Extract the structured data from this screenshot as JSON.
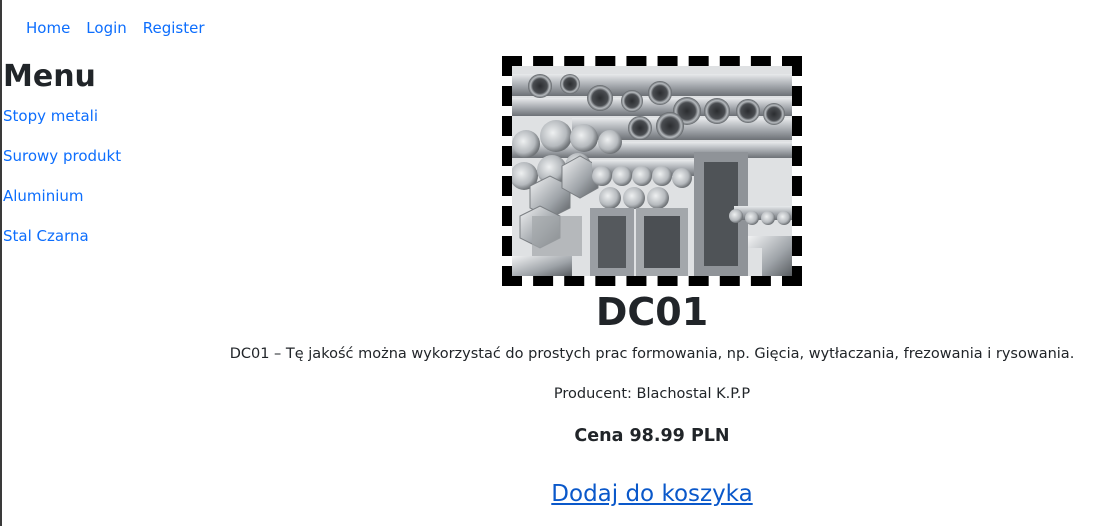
{
  "nav": {
    "home": "Home",
    "login": "Login",
    "register": "Register"
  },
  "sidebar": {
    "title": "Menu",
    "items": [
      {
        "label": "Stopy metali"
      },
      {
        "label": "Surowy produkt"
      },
      {
        "label": "Aluminium"
      },
      {
        "label": "Stal Czarna"
      }
    ]
  },
  "product": {
    "image_alt": "metal-profiles-image",
    "title": "DC01",
    "description": "DC01 – Tę jakość można wykorzystać do prostych prac formowania, np. Gięcia, wytłaczania, frezowania i rysowania.",
    "producer": "Producent: Blachostal K.P.P",
    "price": "Cena 98.99 PLN",
    "add_to_cart": "Dodaj do koszyka"
  },
  "colors": {
    "link": "#0d6efd",
    "text": "#212529",
    "frame": "#000000"
  }
}
